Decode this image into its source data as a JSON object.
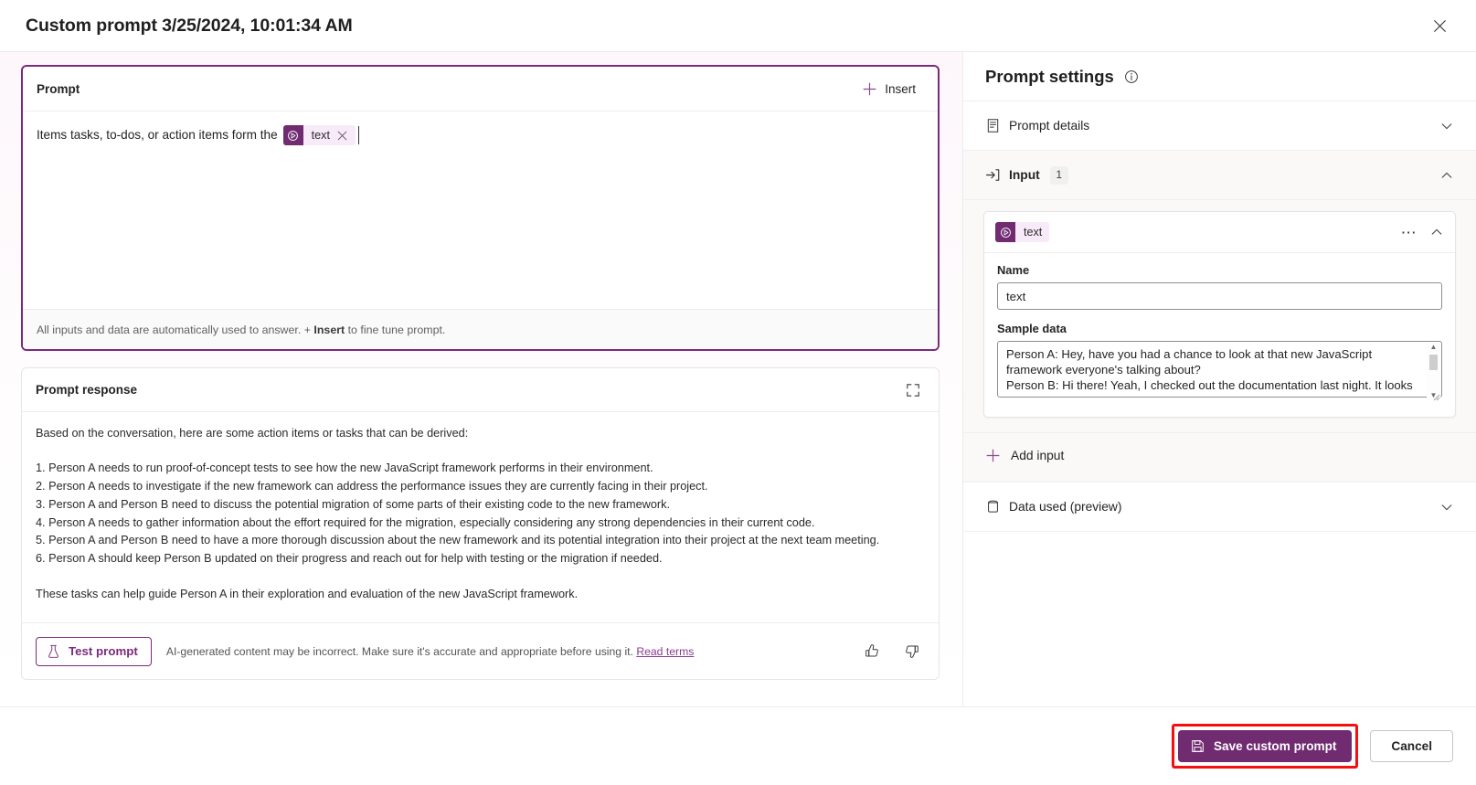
{
  "window": {
    "title": "Custom prompt 3/25/2024, 10:01:34 AM",
    "close_label": "✕"
  },
  "prompt_card": {
    "header_title": "Prompt",
    "insert_label": "Insert",
    "text_before_chip": "Items tasks, to-dos, or action items form the",
    "chip_label": "text",
    "chip_close": "✕",
    "footer_prefix": "All inputs and data are automatically used to answer. + ",
    "footer_bold": "Insert",
    "footer_suffix": " to fine tune prompt."
  },
  "response_card": {
    "header_title": "Prompt response",
    "intro": "Based on the conversation, here are some action items or tasks that can be derived:",
    "items": [
      "1. Person A needs to run proof-of-concept tests to see how the new JavaScript framework performs in their environment.",
      "2. Person A needs to investigate if the new framework can address the performance issues they are currently facing in their project.",
      "3. Person A and Person B need to discuss the potential migration of some parts of their existing code to the new framework.",
      "4. Person A needs to gather information about the effort required for the migration, especially considering any strong dependencies in their current code.",
      "5. Person A and Person B need to have a more thorough discussion about the new framework and its potential integration into their project at the next team meeting.",
      "6. Person A should keep Person B updated on their progress and reach out for help with testing or the migration if needed."
    ],
    "outro": "These tasks can help guide Person A in their exploration and evaluation of the new JavaScript framework.",
    "test_button_label": "Test prompt",
    "disclaimer": "AI-generated content may be incorrect. Make sure it's accurate and appropriate before using it. ",
    "read_terms_label": "Read terms"
  },
  "settings_panel": {
    "title": "Prompt settings",
    "sections": [
      {
        "label": "Prompt details",
        "expanded": false
      },
      {
        "label": "Input",
        "badge": "1",
        "expanded": true
      },
      {
        "label": "Data used (preview)",
        "expanded": false
      }
    ],
    "input_card": {
      "chip_label": "text",
      "name_label": "Name",
      "name_value": "text",
      "sample_label": "Sample data",
      "sample_value": "Person A: Hey, have you had a chance to look at that new JavaScript framework everyone's talking about?\nPerson B: Hi there! Yeah, I checked out the documentation last night. It looks promising. Performance seems solid but there's a"
    },
    "add_input_label": "Add input"
  },
  "footer": {
    "save_label": "Save custom prompt",
    "cancel_label": "Cancel"
  },
  "colors": {
    "accent_purple": "#702b71",
    "chip_bg": "#f9eaf9",
    "highlight_red": "#f60f0f",
    "link_purple": "#8a3a8d"
  }
}
